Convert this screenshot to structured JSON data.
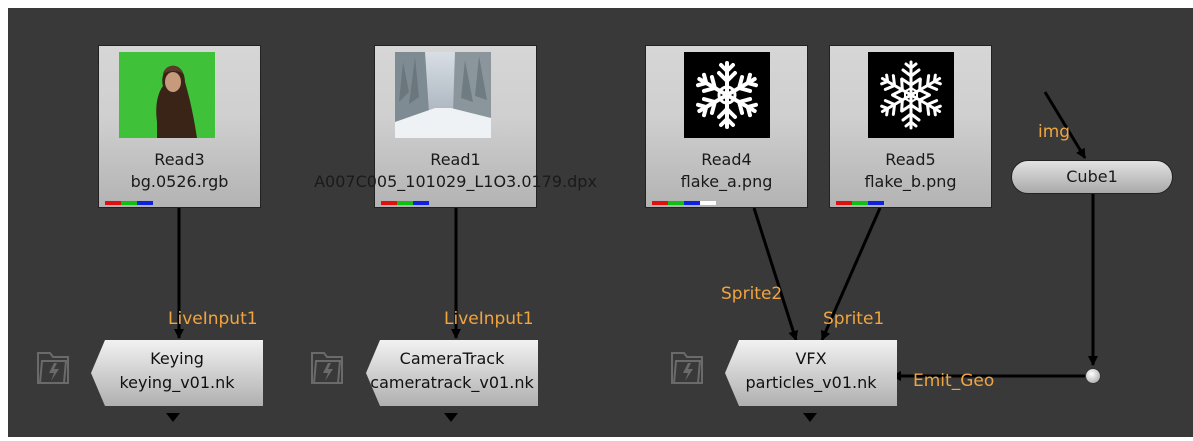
{
  "nodes": {
    "read3": {
      "title": "Read3",
      "file": "bg.0526.rgb"
    },
    "read1": {
      "title": "Read1",
      "file": "A007C005_101029_L1O3.0179.dpx"
    },
    "read4": {
      "title": "Read4",
      "file": "flake_a.png"
    },
    "read5": {
      "title": "Read5",
      "file": "flake_b.png"
    },
    "cube1": {
      "title": "Cube1"
    }
  },
  "groups": {
    "keying": {
      "title": "Keying",
      "file": "keying_v01.nk"
    },
    "cameratrack": {
      "title": "CameraTrack",
      "file": "cameratrack_v01.nk"
    },
    "vfx": {
      "title": "VFX",
      "file": "particles_v01.nk"
    }
  },
  "pipe_labels": {
    "keying_input": "LiveInput1",
    "cameratrack_input": "LiveInput1",
    "vfx_sprite2": "Sprite2",
    "vfx_sprite1": "Sprite1",
    "vfx_emit_geo": "Emit_Geo",
    "cube_img": "img"
  },
  "colors": {
    "background": "#393939",
    "pipe_label": "#f0a540",
    "green_screen": "#3fc23a",
    "channel_red": "#e01010",
    "channel_green": "#10c010",
    "channel_blue": "#1020e0",
    "channel_alpha": "#ffffff"
  },
  "icons": {
    "group_icon": "folder-icon",
    "output_marker": "down-arrow-icon"
  }
}
